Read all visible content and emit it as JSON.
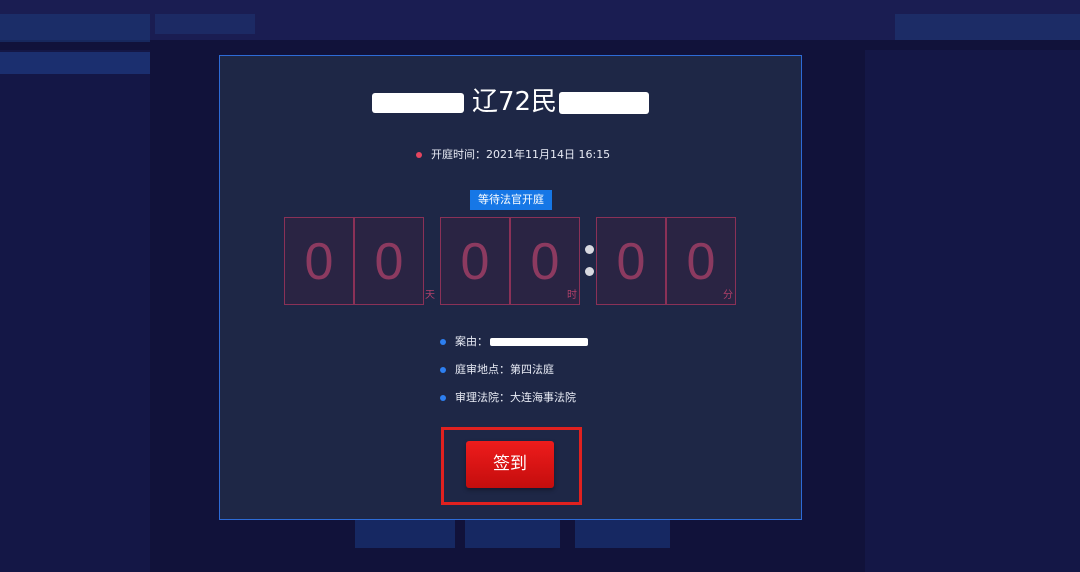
{
  "dialog": {
    "case_title": "辽72民",
    "open_time_label": "开庭时间：",
    "open_time_value": "2021年11月14日 16:15",
    "status_badge": "等待法官开庭",
    "countdown": {
      "days": [
        "0",
        "0"
      ],
      "days_unit": "天",
      "hours": [
        "0",
        "0"
      ],
      "hours_unit": "时",
      "minutes": [
        "0",
        "0"
      ],
      "minutes_unit": "分"
    },
    "info": {
      "cause_label": "案由：",
      "location_label": "庭审地点：",
      "location_value": "第四法庭",
      "court_label": "审理法院：",
      "court_value": "大连海事法院"
    },
    "signin_label": "签到"
  },
  "colors": {
    "dialog_bg": "#1e2746",
    "dialog_border": "#2d6bd6",
    "badge_bg": "#1677e6",
    "countdown_digit": "#8c3a60",
    "signin_button": "#e31515",
    "highlight_box": "#e0211f"
  }
}
